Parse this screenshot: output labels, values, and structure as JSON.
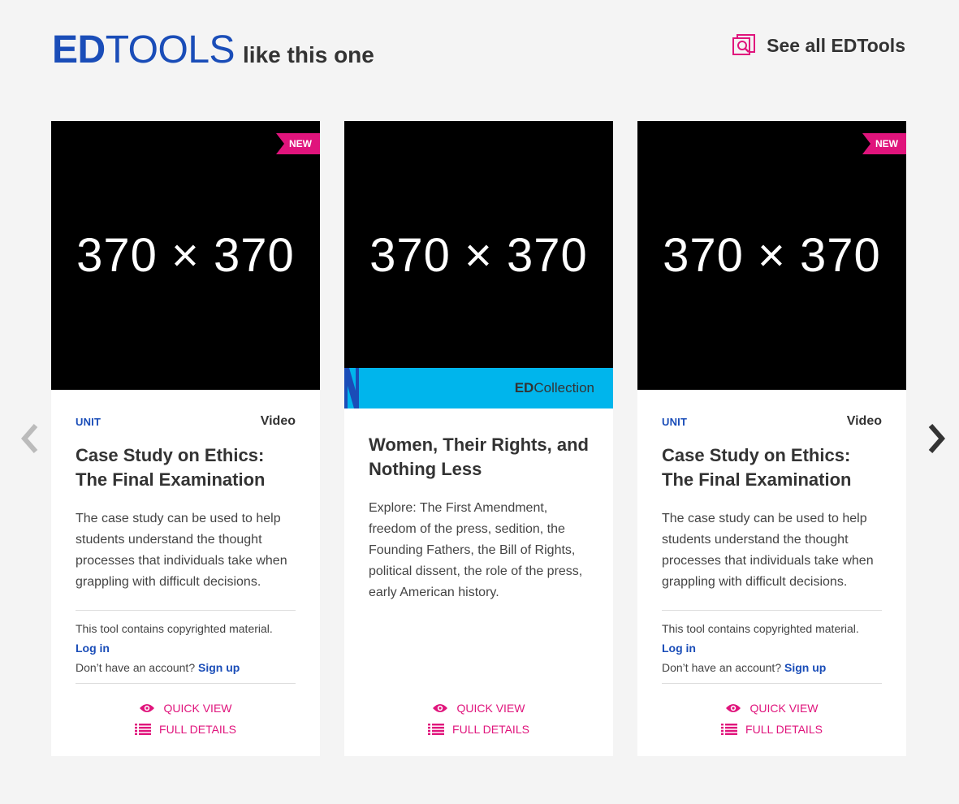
{
  "header": {
    "brand_ed": "ED",
    "brand_tools": "TOOLS",
    "tagline": "like this one",
    "see_all_label": "See all EDTools"
  },
  "colors": {
    "brand_blue": "#1a4db8",
    "accent_pink": "#e0147c",
    "collection_cyan": "#00b5ec",
    "background": "#f4f4f4"
  },
  "cards": [
    {
      "placeholder": "370 × 370",
      "badge": "NEW",
      "kind": "UNIT",
      "media": "Video",
      "title": "Case Study on Ethics: The Final Examination",
      "description": "The case study can be used to help students understand the thought processes that individuals take when grappling with difficult decisions.",
      "copyright_note": "This tool contains copyrighted material.",
      "login_label": "Log in",
      "no_account_text": "Don’t have an account?",
      "signup_label": "Sign up",
      "quick_view_label": "QUICK VIEW",
      "full_details_label": "FULL DETAILS"
    },
    {
      "placeholder": "370 × 370",
      "collection_bold": "ED",
      "collection_rest": "Collection",
      "title": "Women, Their Rights, and Nothing Less",
      "description": "Explore: The First Amendment, freedom of the press, sedition, the Founding Fathers, the Bill of Rights, political dissent, the role of the press, early American history.",
      "quick_view_label": "QUICK VIEW",
      "full_details_label": "FULL DETAILS"
    },
    {
      "placeholder": "370 × 370",
      "badge": "NEW",
      "kind": "UNIT",
      "media": "Video",
      "title": "Case Study on Ethics: The Final Examination",
      "description": "The case study can be used to help students understand the thought processes that individuals take when grappling with difficult decisions.",
      "copyright_note": "This tool contains copyrighted material.",
      "login_label": "Log in",
      "no_account_text": "Don’t have an account?",
      "signup_label": "Sign up",
      "quick_view_label": "QUICK VIEW",
      "full_details_label": "FULL DETAILS"
    }
  ],
  "icons": {
    "see_all": "gallery-search-icon",
    "prev": "chevron-left-icon",
    "next": "chevron-right-icon",
    "quick_view": "eye-icon",
    "full_details": "list-icon"
  }
}
